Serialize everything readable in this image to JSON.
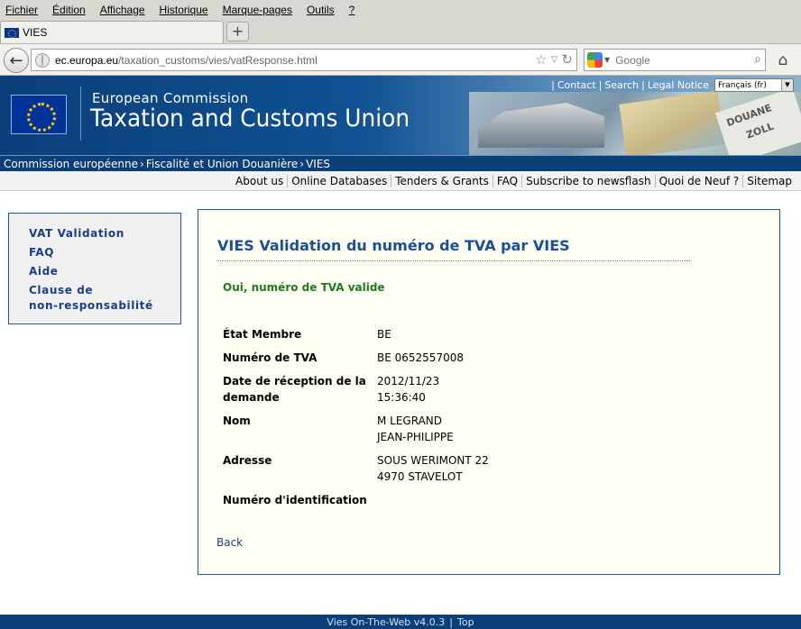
{
  "browser": {
    "menu": [
      "Fichier",
      "Édition",
      "Affichage",
      "Historique",
      "Marque-pages",
      "Outils",
      "?"
    ],
    "tab_title": "VIES",
    "new_tab": "+",
    "url_host": "ec.europa.eu",
    "url_path": "/taxation_customs/vies/vatResponse.html",
    "search_placeholder": "Google"
  },
  "banner": {
    "commission": "European Commission",
    "site_name": "Taxation and Customs Union",
    "top_links": [
      "Contact",
      "Search",
      "Legal Notice"
    ],
    "language": "Français (fr)",
    "stamp_text": [
      "DOUANE",
      "ZOLL"
    ]
  },
  "breadcrumb": [
    "Commission européenne",
    "Fiscalité et Union Douanière",
    "VIES"
  ],
  "service_links": [
    "About us",
    "Online Databases",
    "Tenders & Grants",
    "FAQ",
    "Subscribe to newsflash",
    "Quoi de Neuf ?",
    "Sitemap"
  ],
  "leftnav": {
    "vat_validation": "VAT Validation",
    "faq": "FAQ",
    "aide": "Aide",
    "clause_line1": "Clause de",
    "clause_line2": "non-responsabilité"
  },
  "result": {
    "title": "VIES Validation du numéro de TVA par VIES",
    "valid_message": "Oui, numéro de TVA valide",
    "fields": {
      "etat_label": "État Membre",
      "etat_value": "BE",
      "tva_label": "Numéro de TVA",
      "tva_value": "BE 0652557008",
      "date_label_1": "Date de réception de la",
      "date_label_2": "demande",
      "date_value_1": "2012/11/23",
      "date_value_2": "15:36:40",
      "nom_label": "Nom",
      "nom_value_1": "M LEGRAND",
      "nom_value_2": "JEAN-PHILIPPE",
      "adresse_label": "Adresse",
      "adresse_value_1": "SOUS WERIMONT 22",
      "adresse_value_2": "4970 STAVELOT",
      "ident_label": "Numéro d'identification"
    },
    "back": "Back"
  },
  "footer": {
    "version": "Vies On-The-Web v4.0.3",
    "top": "Top"
  },
  "colors": {
    "ec_blue": "#0b3f7a",
    "link_blue": "#1a3f86",
    "valid_green": "#1d7a1d",
    "panel_bg": "#fffff3"
  }
}
